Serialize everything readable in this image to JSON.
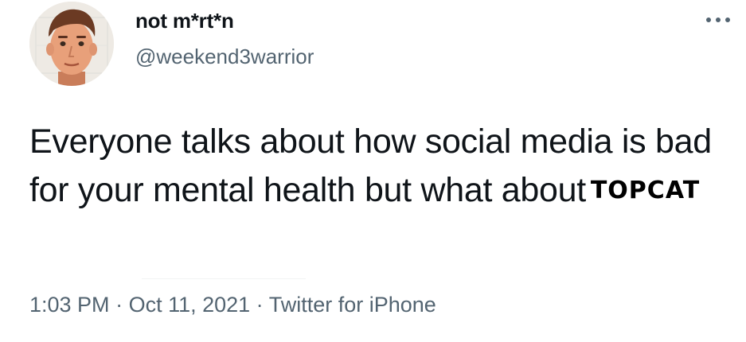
{
  "tweet": {
    "display_name": "not m*rt*n",
    "handle": "@weekend3warrior",
    "more_icon": "ellipsis-icon",
    "avatar_icon": "avatar-cartoon-face",
    "text_main": "Everyone talks about how social media is bad for your mental health but what about",
    "text_emphasis": "TOPCAT",
    "time": "1:03 PM",
    "separator": " · ",
    "date": "Oct 11, 2021",
    "source": "Twitter for iPhone"
  },
  "colors": {
    "text_primary": "#0f1419",
    "text_secondary": "#536471",
    "background": "#ffffff"
  }
}
